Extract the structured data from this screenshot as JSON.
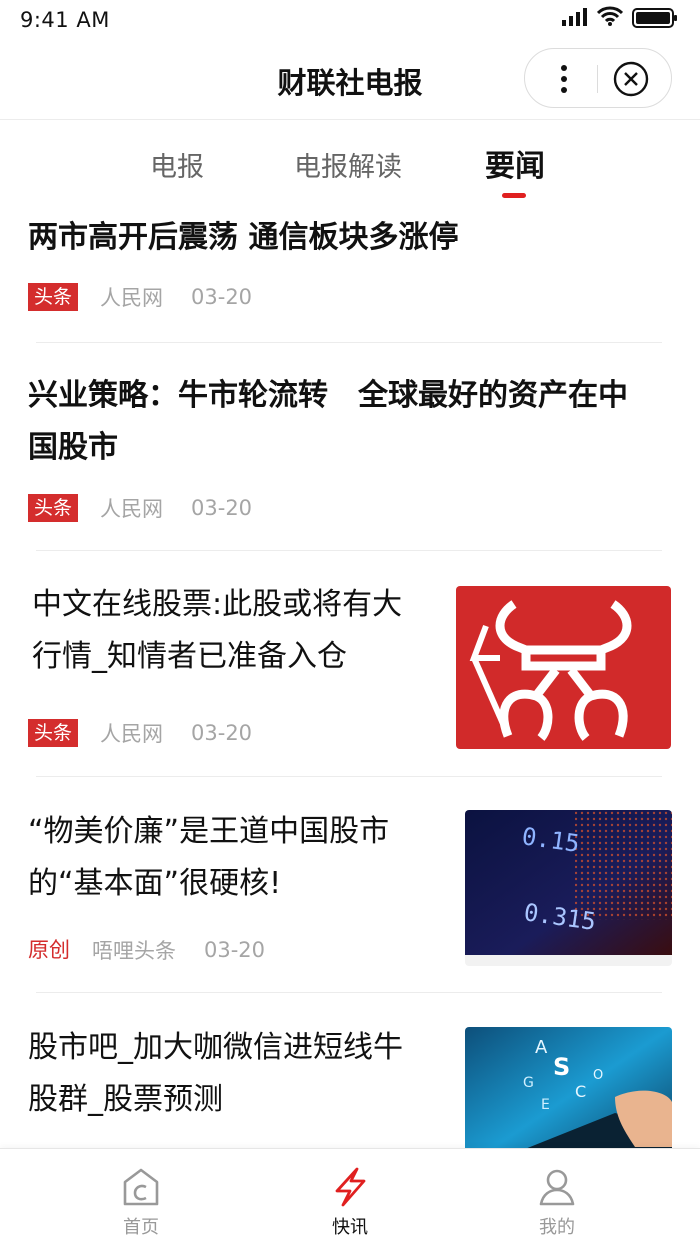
{
  "status_bar": {
    "time": "9:41 AM"
  },
  "header": {
    "title": "财联社电报"
  },
  "tabs": [
    {
      "label": "电报",
      "active": false
    },
    {
      "label": "电报解读",
      "active": false
    },
    {
      "label": "要闻",
      "active": true
    }
  ],
  "news": [
    {
      "title_lines": [
        "两市高开后震荡 通信板块多涨停"
      ],
      "tag": "头条",
      "source": "人民网",
      "date": "03-20"
    },
    {
      "title_lines": [
        "兴业策略：牛市轮流转　全球最好的资产在中",
        "国股市"
      ],
      "tag": "头条",
      "source": "人民网",
      "date": "03-20"
    },
    {
      "title_lines": [
        "中文在线股票:此股或将有大",
        "行情_知情者已准备入仓"
      ],
      "tag": "头条",
      "source": "人民网",
      "date": "03-20"
    },
    {
      "title_lines": [
        "“物美价廉”是王道中国股市",
        "的“基本面”很硬核!"
      ],
      "tag": "原创",
      "source": "唔哩头条",
      "date": "03-20"
    },
    {
      "title_lines": [
        "股市吧_加大咖微信进短线牛",
        "股群_股票预测"
      ]
    }
  ],
  "bottom_tabs": [
    {
      "label": "首页",
      "icon": "home-icon",
      "active": false
    },
    {
      "label": "快讯",
      "icon": "lightning-icon",
      "active": true
    },
    {
      "label": "我的",
      "icon": "user-icon",
      "active": false
    }
  ],
  "colors": {
    "accent": "#e02020",
    "tag": "#d42d2d",
    "meta": "#a5a5a5"
  }
}
